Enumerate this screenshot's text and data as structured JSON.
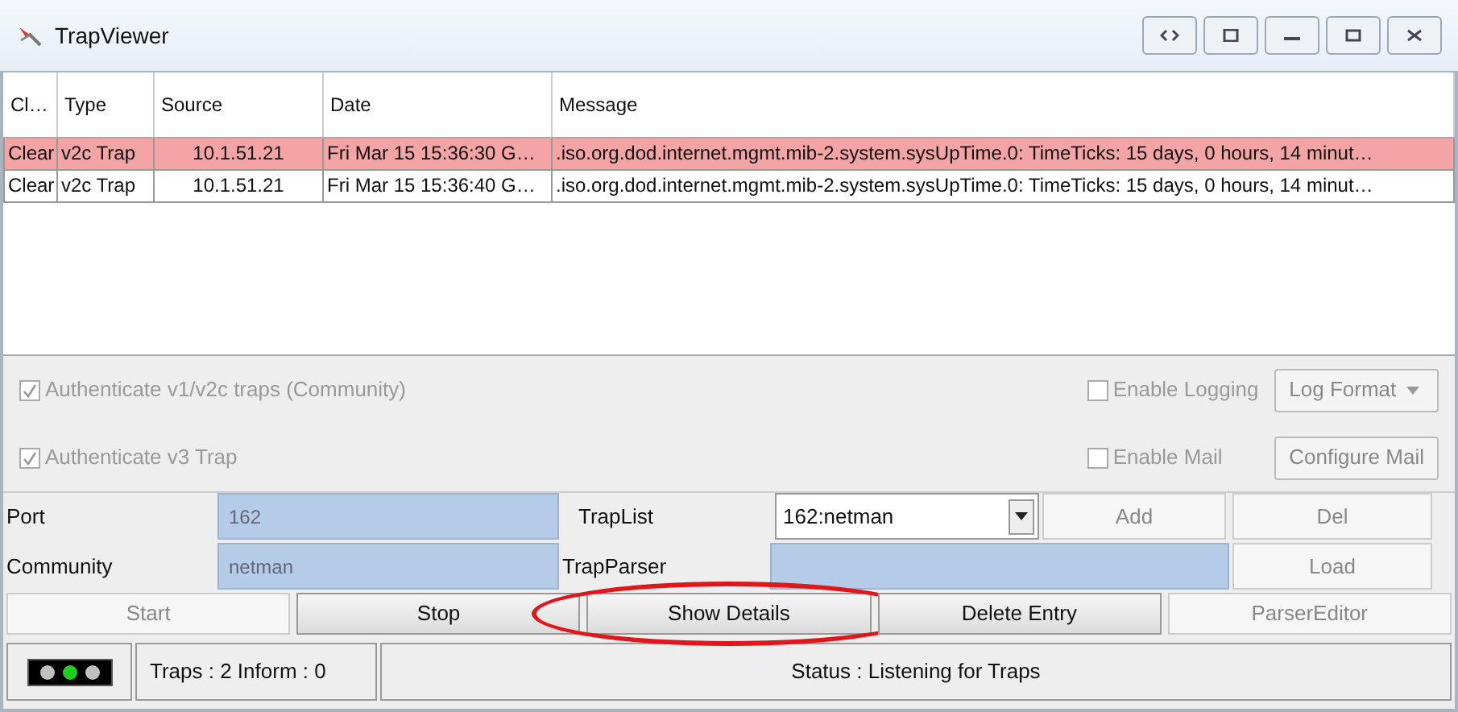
{
  "window": {
    "title": "TrapViewer"
  },
  "table": {
    "columns": [
      "Cl…",
      "Type",
      "Source",
      "Date",
      "Message"
    ],
    "rows": [
      {
        "selected": true,
        "cells": [
          "Clear",
          "v2c Trap",
          "10.1.51.21",
          "Fri Mar 15 15:36:30 G…",
          ".iso.org.dod.internet.mgmt.mib-2.system.sysUpTime.0:  TimeTicks:  15 days, 0 hours, 14 minut…"
        ]
      },
      {
        "selected": false,
        "cells": [
          "Clear",
          "v2c Trap",
          "10.1.51.21",
          "Fri Mar 15 15:36:40 G…",
          ".iso.org.dod.internet.mgmt.mib-2.system.sysUpTime.0:  TimeTicks:  15 days, 0 hours, 14 minut…"
        ]
      }
    ]
  },
  "options": {
    "auth_v1v2c": {
      "label": "Authenticate v1/v2c traps (Community)",
      "checked": true,
      "disabled": true
    },
    "auth_v3": {
      "label": "Authenticate v3 Trap",
      "checked": true,
      "disabled": true
    },
    "enable_logging": {
      "label": "Enable Logging",
      "checked": false,
      "disabled": true
    },
    "log_format": {
      "label": "Log Format",
      "disabled": true
    },
    "enable_mail": {
      "label": "Enable Mail",
      "checked": false,
      "disabled": true
    },
    "configure_mail": {
      "label": "Configure Mail",
      "disabled": true
    }
  },
  "settings": {
    "port": {
      "label": "Port",
      "value": "162"
    },
    "community": {
      "label": "Community",
      "value": "netman"
    },
    "trap_list": {
      "label": "TrapList",
      "value": "162:netman"
    },
    "trap_parser": {
      "label": "TrapParser"
    },
    "add": {
      "label": "Add",
      "disabled": true
    },
    "del": {
      "label": "Del",
      "disabled": true
    },
    "load": {
      "label": "Load",
      "disabled": true
    }
  },
  "actions": [
    {
      "label": "Start",
      "disabled": true,
      "circled": false
    },
    {
      "label": "Stop",
      "disabled": false,
      "circled": false
    },
    {
      "label": "Show Details",
      "disabled": false,
      "circled": true
    },
    {
      "label": "Delete Entry",
      "disabled": false,
      "circled": false
    },
    {
      "label": "ParserEditor",
      "disabled": true,
      "circled": false
    }
  ],
  "status_bar": {
    "lights": [
      {
        "color": "#c0c0c0"
      },
      {
        "color": "#22cc22"
      },
      {
        "color": "#c0c0c0"
      }
    ],
    "counts": "Traps :  2 Inform :  0",
    "status": "Status : Listening for Traps"
  }
}
